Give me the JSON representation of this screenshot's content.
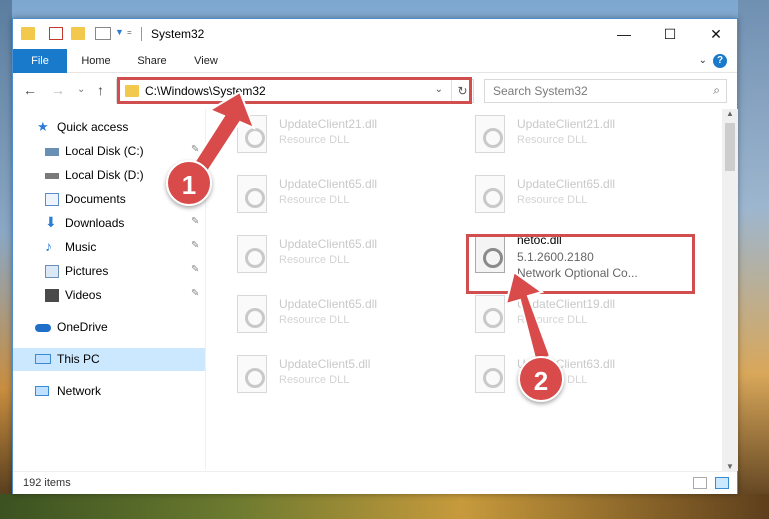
{
  "window": {
    "title": "System32",
    "controls": {
      "minimize": "—",
      "maximize": "☐",
      "close": "✕"
    }
  },
  "ribbon": {
    "tabs": [
      {
        "label": "File"
      },
      {
        "label": "Home"
      },
      {
        "label": "Share"
      },
      {
        "label": "View"
      }
    ],
    "help": "?"
  },
  "address": {
    "path": "C:\\Windows\\System32",
    "refresh": "↻",
    "dropdown": "⌄"
  },
  "search": {
    "placeholder": "Search System32",
    "icon": "⌕"
  },
  "nav": {
    "back": "←",
    "forward": "→",
    "recent": "⌄",
    "up": "↑"
  },
  "sidebar": {
    "items": [
      {
        "label": "Quick access",
        "icon": "star-icon",
        "color": "#2b7cd3"
      },
      {
        "label": "Local Disk (C:)",
        "icon": "drive-icon",
        "color": "#6a8fb5"
      },
      {
        "label": "Local Disk (D:)",
        "icon": "drive-icon",
        "color": "#7a7a7a"
      },
      {
        "label": "Documents",
        "icon": "documents-icon",
        "color": "#5b8bc9"
      },
      {
        "label": "Downloads",
        "icon": "downloads-icon",
        "color": "#2b7cd3"
      },
      {
        "label": "Music",
        "icon": "music-icon",
        "color": "#2b7cd3"
      },
      {
        "label": "Pictures",
        "icon": "pictures-icon",
        "color": "#6a8fb5"
      },
      {
        "label": "Videos",
        "icon": "videos-icon",
        "color": "#4a4a4a"
      },
      {
        "label": "OneDrive",
        "icon": "cloud-icon",
        "color": "#1e6fc9"
      },
      {
        "label": "This PC",
        "icon": "computer-icon",
        "color": "#3a8ad6"
      },
      {
        "label": "Network",
        "icon": "network-icon",
        "color": "#3a8ad6"
      }
    ],
    "pin": "📌"
  },
  "files": [
    {
      "name": "UpdateClient21.dll",
      "type": "Resource DLL"
    },
    {
      "name": "UpdateClient21.dll",
      "type": "Resource DLL"
    },
    {
      "name": "UpdateClient65.dll",
      "type": "Resource DLL"
    },
    {
      "name": "UpdateClient65.dll",
      "type": "Resource DLL"
    },
    {
      "name": "UpdateClient65.dll",
      "type": "Resource DLL"
    },
    {
      "name": "netoc.dll",
      "type": "5.1.2600.2180",
      "desc": "Network Optional Co..."
    },
    {
      "name": "UpdateClient65.dll",
      "type": "Resource DLL"
    },
    {
      "name": "UpdateClient19.dll",
      "type": "Resource DLL"
    },
    {
      "name": "UpdateClient5.dll",
      "type": "Resource DLL"
    },
    {
      "name": "UpdateClient63.dll",
      "type": "Resource DLL"
    }
  ],
  "status": {
    "count": "192 items"
  },
  "annotations": {
    "step1": "1",
    "step2": "2",
    "color": "#d94a4a"
  }
}
